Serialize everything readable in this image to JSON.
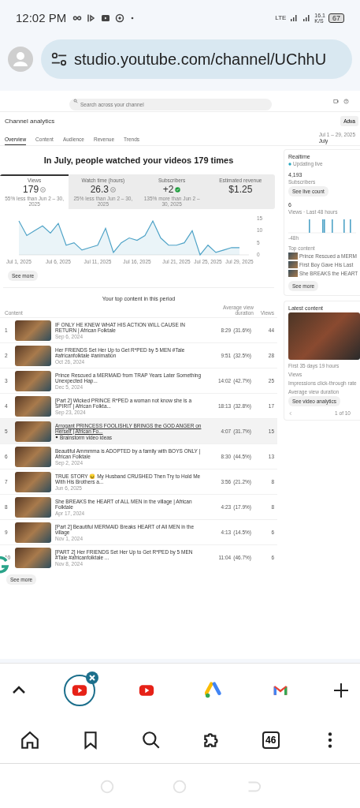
{
  "status_bar": {
    "time": "12:02 PM",
    "network": "LTE",
    "speed": "16.1",
    "speed_unit": "K/S",
    "battery": "67"
  },
  "address_bar": {
    "url": "studio.youtube.com/channel/UChhU"
  },
  "studio": {
    "search": {
      "placeholder": "Search across your channel"
    },
    "title": "Channel analytics",
    "advanced_button": "Adva",
    "tabs": [
      {
        "label": "Overview",
        "selected": true
      },
      {
        "label": "Content",
        "selected": false
      },
      {
        "label": "Audience",
        "selected": false
      },
      {
        "label": "Revenue",
        "selected": false
      },
      {
        "label": "Trends",
        "selected": false
      }
    ],
    "date_range": {
      "range": "Jul 1 – 29, 2025",
      "label": "July"
    },
    "headline": "In July, people watched your videos 179 times",
    "metrics": [
      {
        "label": "Views",
        "value": "179",
        "kind": "info",
        "note": "55% less than Jun 2 – 30, 2025",
        "selected": true
      },
      {
        "label": "Watch time (hours)",
        "value": "26.3",
        "kind": "info",
        "note": "25% less than Jun 2 – 30, 2025",
        "selected": false
      },
      {
        "label": "Subscribers",
        "value": "+2",
        "kind": "check",
        "note": "135% more than Jun 2 – 30, 2025",
        "selected": false
      },
      {
        "label": "Estimated revenue",
        "value": "$1.25",
        "kind": "plain",
        "selected": false
      }
    ],
    "chart_data": {
      "type": "area",
      "categories": [
        "Jul 1, 2025",
        null,
        null,
        null,
        null,
        "Jul 6, 2025",
        null,
        null,
        null,
        null,
        "Jul 11, 2025",
        null,
        null,
        null,
        null,
        "Jul 16, 2025",
        null,
        null,
        null,
        null,
        "Jul 21, 2025",
        null,
        null,
        null,
        "Jul 25, 2025",
        null,
        null,
        null,
        "Jul 29, 2025"
      ],
      "series": [
        {
          "color": "#4fa3c7",
          "values": [
            14,
            8,
            10,
            12,
            9,
            13,
            4,
            5,
            2,
            3,
            4,
            11,
            1,
            5,
            7,
            6,
            8,
            14,
            7,
            4,
            4,
            5,
            10,
            0,
            4,
            1,
            2,
            3,
            3
          ]
        }
      ],
      "ylim": [
        0,
        15
      ],
      "yticks": [
        0,
        5,
        10,
        15
      ]
    },
    "see_more": "See more",
    "top_content": {
      "title": "Your top content in this period",
      "columns": [
        "Content",
        "Average view duration",
        "Views"
      ],
      "rows": [
        {
          "rank": "1",
          "title": "IF ONLY HE KNEW WHAT HIS ACTION WILL CAUSE IN RETURN | African Folktale",
          "date": "Sep 6, 2024",
          "duration": "8:29",
          "percent": "(31.6%)",
          "views": "44",
          "highlighted": false
        },
        {
          "rank": "2",
          "title": "Her FRIENDS Set Her Up to Get R*PED by 5 MEN #Tale #africanfolktale #animation",
          "date": "Oct 26, 2024",
          "duration": "9:51",
          "percent": "(32.5%)",
          "views": "28",
          "highlighted": false
        },
        {
          "rank": "3",
          "title": "Prince Rescued a MERMAID from TRAP Years Later Something Unexpected Hap...",
          "date": "Dec 5, 2024",
          "duration": "14:02",
          "percent": "(42.7%)",
          "views": "25",
          "highlighted": false
        },
        {
          "rank": "4",
          "title": "[Part 2] Wicked PRINCE R*PED a woman not know she is a SPIRIT | African Folkta...",
          "date": "Sep 23, 2024",
          "duration": "18:13",
          "percent": "(32.8%)",
          "views": "17",
          "highlighted": false
        },
        {
          "rank": "5",
          "title": "Arrogant PRINCESS FOOLISHLY BRINGS the GOD ANGER on Herself | African Fo...",
          "tag": "Brainstorm video ideas",
          "duration": "4:07",
          "percent": "(31.7%)",
          "views": "15",
          "highlighted": true
        },
        {
          "rank": "6",
          "title": "Beautiful Ammmma is ADOPTED by a family with BOYS ONLY | African Folktale",
          "date": "Sep 2, 2024",
          "duration": "8:30",
          "percent": "(44.5%)",
          "views": "13",
          "highlighted": false
        },
        {
          "rank": "7",
          "title": "TRUE STORY 😖 My Husband CRUSHED Then Try to Hold Me With His Brothers a...",
          "date": "Jun 6, 2025",
          "duration": "3:56",
          "percent": "(21.2%)",
          "views": "8",
          "highlighted": false
        },
        {
          "rank": "8",
          "title": "She BREAKS the HEART of ALL MEN in the village | African Folktale",
          "date": "Apr 17, 2024",
          "duration": "4:23",
          "percent": "(17.9%)",
          "views": "8",
          "highlighted": false
        },
        {
          "rank": "9",
          "title": "[Part 2] Beautiful MERMAID Breaks HEART of All MEN in the village",
          "date": "Nov 1, 2024",
          "duration": "4:13",
          "percent": "(14.5%)",
          "views": "6",
          "highlighted": false
        },
        {
          "rank": "10",
          "title": "[PART 2] Her FRIENDS Set Her Up to Get R*PED by 5 MEN #Tale #africanfolktale ...",
          "date": "Nov 8, 2024",
          "duration": "11:04",
          "percent": "(46.7%)",
          "views": "6",
          "highlighted": false
        }
      ],
      "see_more": "See more"
    },
    "realtime": {
      "title": "Realtime",
      "status": "Updating live",
      "subscribers": "4,193",
      "subscribers_label": "Subscribers",
      "live_button": "See live count",
      "views": "6",
      "views_label": "Views · Last 48 hours",
      "axis_label": "-48h",
      "top_label": "Top content",
      "top_items": [
        "Prince Rescued a MERM",
        "First Boy Gave His Last",
        "She BREAKS the HEART"
      ],
      "see_more": "See more"
    },
    "latest": {
      "title": "Latest content",
      "period": "First 35 days 19 hours",
      "stats": [
        "Views",
        "Impressions click-through rate",
        "Average view duration"
      ],
      "button": "See video analytics",
      "pager": "1 of 10"
    }
  },
  "browser_tabs": [
    {
      "kind": "youtube",
      "selected": true
    },
    {
      "kind": "youtube",
      "selected": false
    },
    {
      "kind": "ads",
      "selected": false
    },
    {
      "kind": "gmail",
      "selected": false
    }
  ],
  "nav_bar": {
    "tab_count": "46"
  }
}
